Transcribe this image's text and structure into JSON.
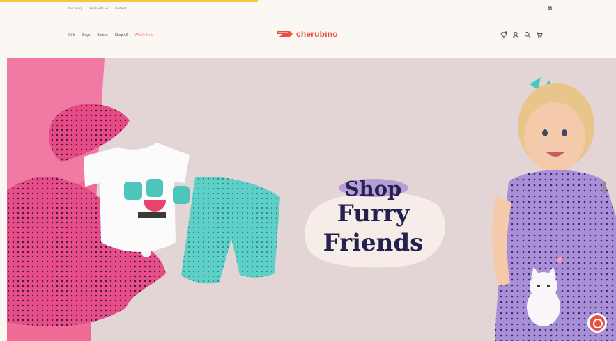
{
  "utility_bar": {
    "links": [
      "Our Story",
      "Work with us",
      "Contact"
    ]
  },
  "nav": {
    "items": [
      "Girls",
      "Boys",
      "Babies",
      "Shop All",
      "What's New"
    ]
  },
  "brand": {
    "name": "cherubino"
  },
  "hero": {
    "line1": "Shop",
    "line2": "Furry",
    "line3": "Friends"
  },
  "icons": [
    "globe-icon",
    "wishlist-icon",
    "account-icon",
    "search-icon",
    "cart-icon",
    "chat-icon"
  ],
  "colors": {
    "brand_red": "#e8503f",
    "sale_link": "#ef7e6b",
    "hero_bg": "#e3d5d6",
    "hero_pink": "#f07aa3",
    "headline": "#24214f",
    "shop_pill": "#b79ed8",
    "notice_bar": "#f6c54a"
  }
}
